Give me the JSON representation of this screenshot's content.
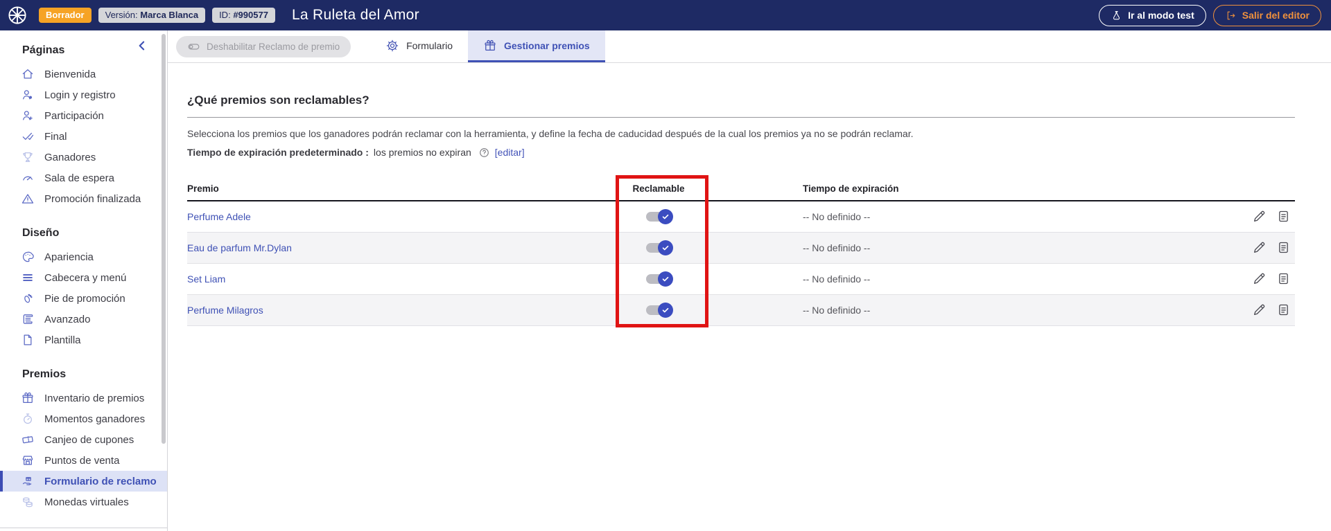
{
  "header": {
    "status_badge": "Borrador",
    "version_label": "Versión:",
    "version_value": "Marca Blanca",
    "id_label": "ID:",
    "id_value": "#990577",
    "title": "La Ruleta del Amor",
    "test_button_label": "Ir al modo test",
    "exit_button_label": "Salir del editor",
    "logo_icon": "roulette-wheel-icon",
    "test_button_icon": "test-tube-icon",
    "exit_button_icon": "exit-icon"
  },
  "toolbar": {
    "disabled_action_label": "Deshabilitar Reclamo de premio",
    "disabled_action_icon": "toggle-icon",
    "tabs": [
      {
        "label": "Formulario",
        "icon": "gear-icon",
        "active": false
      },
      {
        "label": "Gestionar premios",
        "icon": "gift-icon",
        "active": true
      }
    ]
  },
  "sidebar": {
    "collapse_icon": "chevron-left-icon",
    "sections": [
      {
        "title": "Páginas",
        "items": [
          {
            "label": "Bienvenida",
            "icon": "home-icon"
          },
          {
            "label": "Login y registro",
            "icon": "user-badge-icon"
          },
          {
            "label": "Participación",
            "icon": "user-plus-icon"
          },
          {
            "label": "Final",
            "icon": "double-check-icon"
          },
          {
            "label": "Ganadores",
            "icon": "trophy-icon"
          },
          {
            "label": "Sala de espera",
            "icon": "gauge-icon"
          },
          {
            "label": "Promoción finalizada",
            "icon": "warning-icon"
          }
        ]
      },
      {
        "title": "Diseño",
        "items": [
          {
            "label": "Apariencia",
            "icon": "palette-icon"
          },
          {
            "label": "Cabecera y menú",
            "icon": "menu-icon"
          },
          {
            "label": "Pie de promoción",
            "icon": "footprint-icon"
          },
          {
            "label": "Avanzado",
            "icon": "script-icon"
          },
          {
            "label": "Plantilla",
            "icon": "file-icon"
          }
        ]
      },
      {
        "title": "Premios",
        "items": [
          {
            "label": "Inventario de premios",
            "icon": "gift-icon"
          },
          {
            "label": "Momentos ganadores",
            "icon": "stopwatch-icon"
          },
          {
            "label": "Canjeo de cupones",
            "icon": "coupon-icon"
          },
          {
            "label": "Puntos de venta",
            "icon": "store-icon"
          },
          {
            "label": "Formulario de reclamo",
            "icon": "claim-form-icon",
            "active": true
          },
          {
            "label": "Monedas virtuales",
            "icon": "coins-icon"
          }
        ]
      }
    ]
  },
  "main": {
    "heading": "¿Qué premios son reclamables?",
    "description": "Selecciona los premios que los ganadores podrán reclamar con la herramienta, y define la fecha de caducidad después de la cual los premios ya no se podrán reclamar.",
    "expiration_default_label": "Tiempo de expiración predeterminado :",
    "expiration_default_value": "los premios no expiran",
    "help_icon": "question-circle-icon",
    "edit_link_label": "[editar]",
    "table": {
      "columns": {
        "prize": "Premio",
        "claimable": "Reclamable",
        "expiration": "Tiempo de expiración"
      },
      "row_action_icons": [
        "pencil-icon",
        "clipboard-list-icon"
      ],
      "rows": [
        {
          "prize": "Perfume Adele",
          "claimable": true,
          "expiration": "-- No definido --"
        },
        {
          "prize": "Eau de parfum Mr.Dylan",
          "claimable": true,
          "expiration": "-- No definido --"
        },
        {
          "prize": "Set Liam",
          "claimable": true,
          "expiration": "-- No definido --"
        },
        {
          "prize": "Perfume Milagros",
          "claimable": true,
          "expiration": "-- No definido --"
        }
      ]
    }
  },
  "annotation": {
    "type": "highlight-rectangle",
    "color": "#e01414",
    "target": "Reclamable column"
  },
  "colors": {
    "header_bg": "#1e2a64",
    "accent": "#3f51b5",
    "badge_orange": "#f6a325",
    "exit_orange": "#f0913c",
    "toggle_on": "#3b4cc0",
    "annotation_red": "#e01414"
  }
}
